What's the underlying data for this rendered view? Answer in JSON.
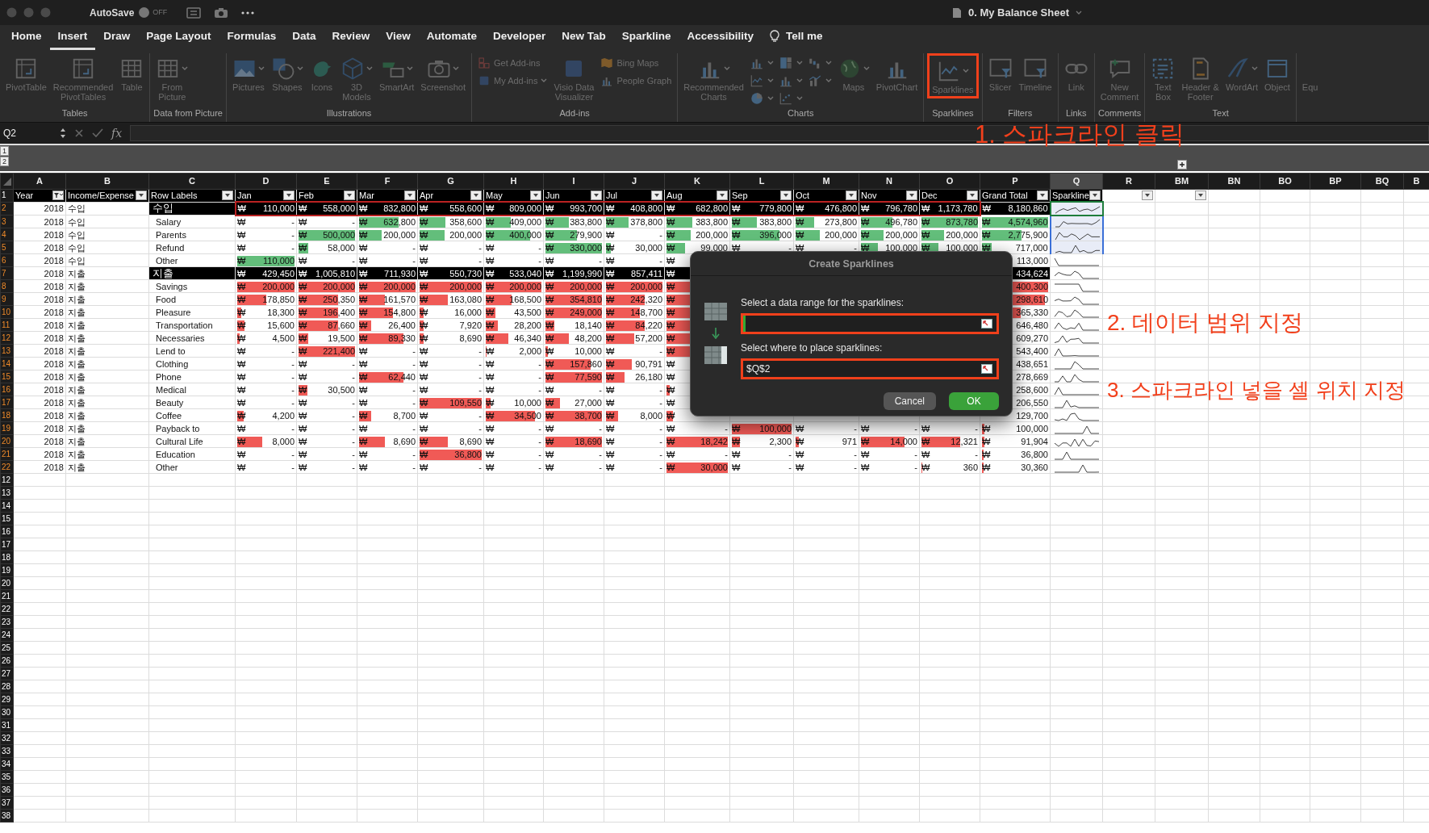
{
  "titlebar": {
    "autosave": {
      "label": "AutoSave",
      "on": false,
      "state_text": "OFF"
    },
    "title": "0. My Balance Sheet"
  },
  "tabs": [
    {
      "label": "Home",
      "selected": false
    },
    {
      "label": "Insert",
      "selected": true
    },
    {
      "label": "Draw",
      "selected": false
    },
    {
      "label": "Page Layout",
      "selected": false
    },
    {
      "label": "Formulas",
      "selected": false
    },
    {
      "label": "Data",
      "selected": false
    },
    {
      "label": "Review",
      "selected": false
    },
    {
      "label": "View",
      "selected": false
    },
    {
      "label": "Automate",
      "selected": false
    },
    {
      "label": "Developer",
      "selected": false
    },
    {
      "label": "New Tab",
      "selected": false
    },
    {
      "label": "Sparkline",
      "selected": false
    },
    {
      "label": "Accessibility",
      "selected": false
    }
  ],
  "tell_me": "Tell me",
  "ribbon": {
    "disabled": true,
    "groups": [
      {
        "label": "Tables",
        "buttons": [
          {
            "kind": "large",
            "label": "PivotTable"
          },
          {
            "kind": "large",
            "label": "Recommended\nPivotTables"
          },
          {
            "kind": "large",
            "label": "Table"
          }
        ]
      },
      {
        "label": "Data from Picture",
        "buttons": [
          {
            "kind": "large",
            "label": "From\nPicture",
            "menu": true
          }
        ]
      },
      {
        "label": "Illustrations",
        "buttons": [
          {
            "kind": "large",
            "label": "Pictures",
            "menu": true
          },
          {
            "kind": "large",
            "label": "Shapes",
            "menu": true
          },
          {
            "kind": "large",
            "label": "Icons"
          },
          {
            "kind": "large",
            "label": "3D\nModels",
            "menu": true
          },
          {
            "kind": "large",
            "label": "SmartArt",
            "menu": true
          },
          {
            "kind": "large",
            "label": "Screenshot",
            "menu": true
          }
        ]
      },
      {
        "label": "Add-ins",
        "buttons": [
          {
            "kind": "stack",
            "buttons": [
              {
                "kind": "small",
                "label": "Get Add-ins"
              },
              {
                "kind": "small",
                "label": "My Add-ins",
                "menu": true
              }
            ]
          },
          {
            "kind": "large",
            "label": "Visio Data\nVisualizer"
          },
          {
            "kind": "stack",
            "buttons": [
              {
                "kind": "small",
                "label": "Bing Maps"
              },
              {
                "kind": "small",
                "label": "People Graph"
              }
            ]
          }
        ]
      },
      {
        "label": "Charts",
        "buttons": [
          {
            "kind": "large",
            "label": "Recommended\nCharts",
            "menu": true
          },
          {
            "kind": "stack",
            "buttons": [
              {
                "kind": "icon",
                "menu": true
              },
              {
                "kind": "icon",
                "menu": true
              },
              {
                "kind": "icon",
                "menu": true
              }
            ]
          },
          {
            "kind": "stack",
            "buttons": [
              {
                "kind": "icon",
                "menu": true
              },
              {
                "kind": "icon",
                "menu": true
              },
              {
                "kind": "icon",
                "menu": true
              }
            ]
          },
          {
            "kind": "stack",
            "buttons": [
              {
                "kind": "icon",
                "menu": true
              },
              {
                "kind": "icon",
                "menu": true
              }
            ]
          },
          {
            "kind": "large",
            "label": "Maps",
            "menu": true
          },
          {
            "kind": "large",
            "label": "PivotChart"
          }
        ]
      },
      {
        "label": "Sparklines",
        "buttons": [
          {
            "kind": "large",
            "label": "Sparklines",
            "menu": true,
            "annotated": true
          }
        ]
      },
      {
        "label": "Filters",
        "buttons": [
          {
            "kind": "large",
            "label": "Slicer"
          },
          {
            "kind": "large",
            "label": "Timeline"
          }
        ]
      },
      {
        "label": "Links",
        "buttons": [
          {
            "kind": "large",
            "label": "Link"
          }
        ]
      },
      {
        "label": "Comments",
        "buttons": [
          {
            "kind": "large",
            "label": "New\nComment"
          }
        ]
      },
      {
        "label": "Text",
        "buttons": [
          {
            "kind": "large",
            "label": "Text\nBox"
          },
          {
            "kind": "large",
            "label": "Header &\nFooter"
          },
          {
            "kind": "large",
            "label": "WordArt",
            "menu": true
          },
          {
            "kind": "large",
            "label": "Object"
          }
        ]
      },
      {
        "buttons": [
          {
            "kind": "large",
            "label": "Equ"
          }
        ]
      }
    ]
  },
  "formula_bar": {
    "name_box": "Q2",
    "fx_label": "fx"
  },
  "outline": {
    "levels": [
      "1",
      "2"
    ]
  },
  "columns": [
    {
      "label": "A",
      "selected": false
    },
    {
      "label": "B",
      "selected": false
    },
    {
      "label": "C",
      "selected": false
    },
    {
      "label": "D",
      "selected": false
    },
    {
      "label": "E",
      "selected": false
    },
    {
      "label": "F",
      "selected": false
    },
    {
      "label": "G",
      "selected": false
    },
    {
      "label": "H",
      "selected": false
    },
    {
      "label": "I",
      "selected": false
    },
    {
      "label": "J",
      "selected": false
    },
    {
      "label": "K",
      "selected": false
    },
    {
      "label": "L",
      "selected": false
    },
    {
      "label": "M",
      "selected": false
    },
    {
      "label": "N",
      "selected": false
    },
    {
      "label": "O",
      "selected": false
    },
    {
      "label": "P",
      "selected": false
    },
    {
      "label": "Q",
      "selected": true
    },
    {
      "label": "R",
      "selected": false
    },
    {
      "label": "BM",
      "selected": false
    },
    {
      "label": "BN",
      "selected": false
    },
    {
      "label": "BO",
      "selected": false
    },
    {
      "label": "BP",
      "selected": false
    },
    {
      "label": "BQ",
      "selected": false
    },
    {
      "label": "B",
      "selected": false
    }
  ],
  "header_row": {
    "num": "1",
    "cells": [
      {
        "label": "Year",
        "filtered": true
      },
      {
        "label": "Income/Expense",
        "filtered": false
      },
      {
        "label": "Row Labels",
        "filtered": false
      },
      {
        "label": "Jan",
        "filtered": false
      },
      {
        "label": "Feb",
        "filtered": false
      },
      {
        "label": "Mar",
        "filtered": false
      },
      {
        "label": "Apr",
        "filtered": false
      },
      {
        "label": "May",
        "filtered": false
      },
      {
        "label": "Jun",
        "filtered": false
      },
      {
        "label": "Jul",
        "filtered": false
      },
      {
        "label": "Aug",
        "filtered": false
      },
      {
        "label": "Sep",
        "filtered": false
      },
      {
        "label": "Oct",
        "filtered": false
      },
      {
        "label": "Nov",
        "filtered": false
      },
      {
        "label": "Dec",
        "filtered": false
      },
      {
        "label": "Grand Total",
        "filtered": false
      },
      {
        "label": "Sparkline",
        "filtered": false
      },
      {
        "filtered": false
      },
      {
        "filtered": false
      }
    ]
  },
  "rows": [
    {
      "num": "2",
      "year": "2018",
      "type": "수입",
      "label": "수입",
      "kind": "income_total",
      "spark": {
        "selected": true,
        "active": true
      },
      "cells": [
        {
          "cur": "₩",
          "amt": "110,000"
        },
        {
          "cur": "₩",
          "amt": "558,000"
        },
        {
          "cur": "₩",
          "amt": "832,800"
        },
        {
          "cur": "₩",
          "amt": "558,600"
        },
        {
          "cur": "₩",
          "amt": "809,000"
        },
        {
          "cur": "₩",
          "amt": "993,700"
        },
        {
          "cur": "₩",
          "amt": "408,800"
        },
        {
          "cur": "₩",
          "amt": "682,800"
        },
        {
          "cur": "₩",
          "amt": "779,800"
        },
        {
          "cur": "₩",
          "amt": "476,800"
        },
        {
          "cur": "₩",
          "amt": "796,780"
        },
        {
          "cur": "₩",
          "amt": "1,173,780"
        },
        {
          "cur": "₩",
          "amt": "8,180,860"
        }
      ]
    },
    {
      "num": "3",
      "year": "2018",
      "type": "수입",
      "label": "Salary",
      "kind": "income",
      "spark": {
        "selected": true,
        "active": false
      },
      "cells": [
        {
          "cur": "₩",
          "amt": "-"
        },
        {
          "cur": "₩",
          "amt": "-"
        },
        {
          "cur": "₩",
          "amt": "632,800",
          "level": 0.7
        },
        {
          "cur": "₩",
          "amt": "358,600",
          "level": 0.42
        },
        {
          "cur": "₩",
          "amt": "409,000",
          "level": 0.45
        },
        {
          "cur": "₩",
          "amt": "383,800",
          "level": 0.42
        },
        {
          "cur": "₩",
          "amt": "378,800",
          "level": 0.4
        },
        {
          "cur": "₩",
          "amt": "383,800",
          "level": 0.42
        },
        {
          "cur": "₩",
          "amt": "383,800",
          "level": 0.42
        },
        {
          "cur": "₩",
          "amt": "273,800",
          "level": 0.3
        },
        {
          "cur": "₩",
          "amt": "496,780",
          "level": 0.56
        },
        {
          "cur": "₩",
          "amt": "873,780",
          "level": 1
        },
        {
          "cur": "₩",
          "amt": "4,574,960",
          "level": 1
        }
      ]
    },
    {
      "num": "4",
      "year": "2018",
      "type": "수입",
      "label": "Parents",
      "kind": "income",
      "spark": {
        "selected": true,
        "active": false
      },
      "cells": [
        {
          "cur": "₩",
          "amt": "-"
        },
        {
          "cur": "₩",
          "amt": "500,000",
          "level": 1
        },
        {
          "cur": "₩",
          "amt": "200,000",
          "level": 0.4
        },
        {
          "cur": "₩",
          "amt": "200,000",
          "level": 0.4
        },
        {
          "cur": "₩",
          "amt": "400,000",
          "level": 0.8
        },
        {
          "cur": "₩",
          "amt": "279,900",
          "level": 0.55
        },
        {
          "cur": "₩",
          "amt": "-"
        },
        {
          "cur": "₩",
          "amt": "200,000",
          "level": 0.4
        },
        {
          "cur": "₩",
          "amt": "396,000",
          "level": 0.8
        },
        {
          "cur": "₩",
          "amt": "200,000",
          "level": 0.4
        },
        {
          "cur": "₩",
          "amt": "200,000",
          "level": 0.4
        },
        {
          "cur": "₩",
          "amt": "200,000",
          "level": 0.4
        },
        {
          "cur": "₩",
          "amt": "2,775,900",
          "level": 0.6
        }
      ]
    },
    {
      "num": "5",
      "year": "2018",
      "type": "수입",
      "label": "Refund",
      "kind": "income",
      "spark": {
        "selected": true,
        "active": false
      },
      "cells": [
        {
          "cur": "₩",
          "amt": "-"
        },
        {
          "cur": "₩",
          "amt": "58,000",
          "level": 0.17
        },
        {
          "cur": "₩",
          "amt": "-"
        },
        {
          "cur": "₩",
          "amt": "-"
        },
        {
          "cur": "₩",
          "amt": "-"
        },
        {
          "cur": "₩",
          "amt": "330,000",
          "level": 1
        },
        {
          "cur": "₩",
          "amt": "30,000",
          "level": 0.09
        },
        {
          "cur": "₩",
          "amt": "99,000",
          "level": 0.3
        },
        {
          "cur": "₩",
          "amt": "-"
        },
        {
          "cur": "₩",
          "amt": "-"
        },
        {
          "cur": "₩",
          "amt": "100,000",
          "level": 0.3
        },
        {
          "cur": "₩",
          "amt": "100,000",
          "level": 0.3
        },
        {
          "cur": "₩",
          "amt": "717,000",
          "level": 0.15
        }
      ]
    },
    {
      "num": "6",
      "year": "2018",
      "type": "수입",
      "label": "Other",
      "kind": "income",
      "spark": {
        "selected": false,
        "active": false
      },
      "cells": [
        {
          "cur": "₩",
          "amt": "110,000",
          "level": 1
        },
        {
          "cur": "₩",
          "amt": "-"
        },
        {
          "cur": "₩",
          "amt": "-"
        },
        {
          "cur": "₩",
          "amt": "-"
        },
        {
          "cur": "₩",
          "amt": "-"
        },
        {
          "cur": "₩",
          "amt": "-"
        },
        {
          "cur": "₩",
          "amt": "-"
        },
        {
          "cur": "₩"
        },
        null,
        null,
        null,
        null,
        {
          "amt": "113,000"
        }
      ]
    },
    {
      "num": "7",
      "year": "2018",
      "type": "지출",
      "label": "지출",
      "kind": "expense_total",
      "spark": {
        "selected": false,
        "active": false
      },
      "cells": [
        {
          "cur": "₩",
          "amt": "429,450"
        },
        {
          "cur": "₩",
          "amt": "1,005,810"
        },
        {
          "cur": "₩",
          "amt": "711,930"
        },
        {
          "cur": "₩",
          "amt": "550,730"
        },
        {
          "cur": "₩",
          "amt": "533,040"
        },
        {
          "cur": "₩",
          "amt": "1,199,990"
        },
        {
          "cur": "₩",
          "amt": "857,411"
        },
        {
          "cur": "₩"
        },
        null,
        null,
        null,
        null,
        {
          "amt": "434,624"
        }
      ]
    },
    {
      "num": "8",
      "year": "2018",
      "type": "지출",
      "label": "Savings",
      "kind": "expense",
      "spark": {
        "selected": false,
        "active": false
      },
      "cells": [
        {
          "cur": "₩",
          "amt": "200,000",
          "level": 1
        },
        {
          "cur": "₩",
          "amt": "200,000",
          "level": 1
        },
        {
          "cur": "₩",
          "amt": "200,000",
          "level": 1
        },
        {
          "cur": "₩",
          "amt": "200,000",
          "level": 1
        },
        {
          "cur": "₩",
          "amt": "200,000",
          "level": 1
        },
        {
          "cur": "₩",
          "amt": "200,000",
          "level": 1
        },
        {
          "cur": "₩",
          "amt": "200,000",
          "level": 1
        },
        {
          "cur": "₩",
          "level": 1
        },
        null,
        null,
        null,
        null,
        {
          "amt": "400,300",
          "level": 1
        }
      ]
    },
    {
      "num": "9",
      "year": "2018",
      "type": "지출",
      "label": "Food",
      "kind": "expense",
      "spark": {
        "selected": false,
        "active": false
      },
      "cells": [
        {
          "cur": "₩",
          "amt": "178,850",
          "level": 0.5
        },
        {
          "cur": "₩",
          "amt": "250,350",
          "level": 0.7
        },
        {
          "cur": "₩",
          "amt": "161,570",
          "level": 0.45
        },
        {
          "cur": "₩",
          "amt": "163,080",
          "level": 0.46
        },
        {
          "cur": "₩",
          "amt": "168,500",
          "level": 0.47
        },
        {
          "cur": "₩",
          "amt": "354,810",
          "level": 1
        },
        {
          "cur": "₩",
          "amt": "242,320",
          "level": 0.68
        },
        {
          "cur": "₩",
          "level": 0.5
        },
        null,
        null,
        null,
        null,
        {
          "amt": "298,610",
          "level": 0.95
        }
      ]
    },
    {
      "num": "10",
      "year": "2018",
      "type": "지출",
      "label": "Pleasure",
      "kind": "expense",
      "spark": {
        "selected": false,
        "active": false
      },
      "cells": [
        {
          "cur": "₩",
          "amt": "18,300",
          "level": 0.07
        },
        {
          "cur": "₩",
          "amt": "196,400",
          "level": 0.7
        },
        {
          "cur": "₩",
          "amt": "154,800",
          "level": 0.6
        },
        {
          "cur": "₩",
          "amt": "16,000",
          "level": 0.06
        },
        {
          "cur": "₩",
          "amt": "43,500",
          "level": 0.17
        },
        {
          "cur": "₩",
          "amt": "249,000",
          "level": 1
        },
        {
          "cur": "₩",
          "amt": "148,700",
          "level": 0.6
        },
        {
          "cur": "₩",
          "level": 0.5
        },
        null,
        null,
        null,
        null,
        {
          "amt": "365,330",
          "level": 0.58
        }
      ]
    },
    {
      "num": "11",
      "year": "2018",
      "type": "지출",
      "label": "Transportation",
      "kind": "expense",
      "spark": {
        "selected": false,
        "active": false
      },
      "cells": [
        {
          "cur": "₩",
          "amt": "15,600",
          "level": 0.13
        },
        {
          "cur": "₩",
          "amt": "87,660",
          "level": 0.7
        },
        {
          "cur": "₩",
          "amt": "26,400",
          "level": 0.22
        },
        {
          "cur": "₩",
          "amt": "7,920",
          "level": 0.06
        },
        {
          "cur": "₩",
          "amt": "28,200",
          "level": 0.22
        },
        {
          "cur": "₩",
          "amt": "18,140",
          "level": 0.15
        },
        {
          "cur": "₩",
          "amt": "84,220",
          "level": 0.68
        },
        {
          "cur": "₩",
          "level": 0.5
        },
        null,
        null,
        null,
        null,
        {
          "amt": "646,480"
        }
      ]
    },
    {
      "num": "12",
      "year": "2018",
      "type": "지출",
      "label": "Necessaries",
      "kind": "expense",
      "spark": {
        "selected": false,
        "active": false
      },
      "cells": [
        {
          "cur": "₩",
          "amt": "4,500",
          "level": 0.04
        },
        {
          "cur": "₩",
          "amt": "19,500",
          "level": 0.17
        },
        {
          "cur": "₩",
          "amt": "89,330",
          "level": 0.78
        },
        {
          "cur": "₩",
          "amt": "8,690",
          "level": 0.07
        },
        {
          "cur": "₩",
          "amt": "46,340",
          "level": 0.4
        },
        {
          "cur": "₩",
          "amt": "48,200",
          "level": 0.42
        },
        {
          "cur": "₩",
          "amt": "57,200",
          "level": 0.5
        },
        {
          "cur": "₩",
          "level": 0.5
        },
        null,
        null,
        null,
        null,
        {
          "amt": "609,270"
        }
      ]
    },
    {
      "num": "13",
      "year": "2018",
      "type": "지출",
      "label": "Lend to",
      "kind": "expense",
      "spark": {
        "selected": false,
        "active": false
      },
      "cells": [
        {
          "cur": "₩",
          "amt": "-"
        },
        {
          "cur": "₩",
          "amt": "221,400",
          "level": 1
        },
        {
          "cur": "₩",
          "amt": "-"
        },
        {
          "cur": "₩",
          "amt": "-"
        },
        {
          "cur": "₩",
          "amt": "2,000",
          "level": 0.01
        },
        {
          "cur": "₩",
          "amt": "10,000",
          "level": 0.04
        },
        {
          "cur": "₩",
          "amt": "-"
        },
        {
          "cur": "₩",
          "level": 0.5
        },
        null,
        null,
        null,
        null,
        {
          "amt": "543,400"
        }
      ]
    },
    {
      "num": "14",
      "year": "2018",
      "type": "지출",
      "label": "Clothing",
      "kind": "expense",
      "spark": {
        "selected": false,
        "active": false
      },
      "cells": [
        {
          "cur": "₩",
          "amt": "-"
        },
        {
          "cur": "₩",
          "amt": "-"
        },
        {
          "cur": "₩",
          "amt": "-"
        },
        {
          "cur": "₩",
          "amt": "-"
        },
        {
          "cur": "₩",
          "amt": "-"
        },
        {
          "cur": "₩",
          "amt": "157,860",
          "level": 0.8
        },
        {
          "cur": "₩",
          "amt": "90,791",
          "level": 0.46
        },
        {
          "cur": "₩"
        },
        null,
        null,
        null,
        null,
        {
          "amt": "438,651"
        }
      ]
    },
    {
      "num": "15",
      "year": "2018",
      "type": "지출",
      "label": "Phone",
      "kind": "expense",
      "spark": {
        "selected": false,
        "active": false
      },
      "cells": [
        {
          "cur": "₩",
          "amt": "-"
        },
        {
          "cur": "₩",
          "amt": "-"
        },
        {
          "cur": "₩",
          "amt": "62,440",
          "level": 0.78
        },
        {
          "cur": "₩",
          "amt": "-"
        },
        {
          "cur": "₩",
          "amt": "-"
        },
        {
          "cur": "₩",
          "amt": "77,590",
          "level": 1
        },
        {
          "cur": "₩",
          "amt": "26,180",
          "level": 0.33
        },
        {
          "cur": "₩"
        },
        null,
        null,
        null,
        null,
        {
          "amt": "278,669"
        }
      ]
    },
    {
      "num": "16",
      "year": "2018",
      "type": "지출",
      "label": "Medical",
      "kind": "expense",
      "spark": {
        "selected": false,
        "active": false
      },
      "cells": [
        {
          "cur": "₩",
          "amt": "-"
        },
        {
          "cur": "₩",
          "amt": "30,500",
          "level": 0.15
        },
        {
          "cur": "₩",
          "amt": "-"
        },
        {
          "cur": "₩",
          "amt": "-"
        },
        {
          "cur": "₩",
          "amt": "-"
        },
        {
          "cur": "₩",
          "amt": "-"
        },
        {
          "cur": "₩",
          "amt": "-"
        },
        {
          "cur": "₩",
          "level": 0.05
        },
        null,
        null,
        null,
        null,
        {
          "amt": "258,600"
        }
      ]
    },
    {
      "num": "17",
      "year": "2018",
      "type": "지출",
      "label": "Beauty",
      "kind": "expense",
      "spark": {
        "selected": false,
        "active": false
      },
      "cells": [
        {
          "cur": "₩",
          "amt": "-"
        },
        {
          "cur": "₩",
          "amt": "-"
        },
        {
          "cur": "₩",
          "amt": "-"
        },
        {
          "cur": "₩",
          "amt": "109,550",
          "level": 1
        },
        {
          "cur": "₩",
          "amt": "10,000",
          "level": 0.09
        },
        {
          "cur": "₩",
          "amt": "27,000",
          "level": 0.25
        },
        {
          "cur": "₩",
          "amt": "-"
        },
        {
          "cur": "₩"
        },
        null,
        null,
        null,
        null,
        {
          "amt": "206,550"
        }
      ]
    },
    {
      "num": "18",
      "year": "2018",
      "type": "지출",
      "label": "Coffee",
      "kind": "expense",
      "spark": {
        "selected": false,
        "active": false
      },
      "cells": [
        {
          "cur": "₩",
          "amt": "4,200",
          "level": 0.11
        },
        {
          "cur": "₩",
          "amt": "-"
        },
        {
          "cur": "₩",
          "amt": "8,700",
          "level": 0.22
        },
        {
          "cur": "₩",
          "amt": "-"
        },
        {
          "cur": "₩",
          "amt": "34,500",
          "level": 0.89
        },
        {
          "cur": "₩",
          "amt": "38,700",
          "level": 1
        },
        {
          "cur": "₩",
          "amt": "8,000",
          "level": 0.21
        },
        {
          "cur": "₩",
          "level": 0.1
        },
        null,
        null,
        null,
        null,
        {
          "amt": "129,700"
        }
      ]
    },
    {
      "num": "19",
      "year": "2018",
      "type": "지출",
      "label": "Payback to",
      "kind": "expense",
      "spark": {
        "selected": false,
        "active": false
      },
      "cells": [
        {
          "cur": "₩",
          "amt": "-"
        },
        {
          "cur": "₩",
          "amt": "-"
        },
        {
          "cur": "₩",
          "amt": "-"
        },
        {
          "cur": "₩",
          "amt": "-"
        },
        {
          "cur": "₩",
          "amt": "-"
        },
        {
          "cur": "₩",
          "amt": "-"
        },
        {
          "cur": "₩",
          "amt": "-"
        },
        {
          "cur": "₩",
          "amt": "-"
        },
        {
          "cur": "₩",
          "amt": "100,000",
          "level": 1
        },
        {
          "cur": "₩",
          "amt": "-"
        },
        {
          "cur": "₩",
          "amt": "-"
        },
        {
          "cur": "₩",
          "amt": "-"
        },
        {
          "cur": "₩",
          "amt": "100,000",
          "level": 0.04
        }
      ]
    },
    {
      "num": "20",
      "year": "2018",
      "type": "지출",
      "label": "Cultural Life",
      "kind": "expense",
      "spark": {
        "selected": false,
        "active": false
      },
      "cells": [
        {
          "cur": "₩",
          "amt": "8,000",
          "level": 0.43
        },
        {
          "cur": "₩",
          "amt": "-"
        },
        {
          "cur": "₩",
          "amt": "8,690",
          "level": 0.46
        },
        {
          "cur": "₩",
          "amt": "8,690",
          "level": 0.46
        },
        {
          "cur": "₩",
          "amt": "-"
        },
        {
          "cur": "₩",
          "amt": "18,690",
          "level": 1
        },
        {
          "cur": "₩",
          "amt": "-"
        },
        {
          "cur": "₩",
          "amt": "18,242",
          "level": 1
        },
        {
          "cur": "₩",
          "amt": "2,300",
          "level": 0.13
        },
        {
          "cur": "₩",
          "amt": "971",
          "level": 0.05
        },
        {
          "cur": "₩",
          "amt": "14,000",
          "level": 0.77
        },
        {
          "cur": "₩",
          "amt": "12,321",
          "level": 0.68
        },
        {
          "cur": "₩",
          "amt": "91,904",
          "level": 0.04
        }
      ]
    },
    {
      "num": "21",
      "year": "2018",
      "type": "지출",
      "label": "Education",
      "kind": "expense",
      "spark": {
        "selected": false,
        "active": false
      },
      "cells": [
        {
          "cur": "₩",
          "amt": "-"
        },
        {
          "cur": "₩",
          "amt": "-"
        },
        {
          "cur": "₩",
          "amt": "-"
        },
        {
          "cur": "₩",
          "amt": "36,800",
          "level": 1
        },
        {
          "cur": "₩",
          "amt": "-"
        },
        {
          "cur": "₩",
          "amt": "-"
        },
        {
          "cur": "₩",
          "amt": "-"
        },
        {
          "cur": "₩",
          "amt": "-"
        },
        {
          "cur": "₩",
          "amt": "-"
        },
        {
          "cur": "₩",
          "amt": "-"
        },
        {
          "cur": "₩",
          "amt": "-"
        },
        {
          "cur": "₩",
          "amt": "-"
        },
        {
          "cur": "₩",
          "amt": "36,800",
          "level": 0.02
        }
      ]
    },
    {
      "num": "22",
      "year": "2018",
      "type": "지출",
      "label": "Other",
      "kind": "expense",
      "spark": {
        "selected": false,
        "active": false
      },
      "cells": [
        {
          "cur": "₩",
          "amt": "-"
        },
        {
          "cur": "₩",
          "amt": "-"
        },
        {
          "cur": "₩",
          "amt": "-"
        },
        {
          "cur": "₩",
          "amt": "-"
        },
        {
          "cur": "₩",
          "amt": "-"
        },
        {
          "cur": "₩",
          "amt": "-"
        },
        {
          "cur": "₩",
          "amt": "-"
        },
        {
          "cur": "₩",
          "amt": "30,000",
          "level": 1
        },
        {
          "cur": "₩",
          "amt": "-"
        },
        {
          "cur": "₩",
          "amt": "-"
        },
        {
          "cur": "₩",
          "amt": "-"
        },
        {
          "cur": "₩",
          "amt": "360",
          "level": 0.01
        },
        {
          "cur": "₩",
          "amt": "30,360",
          "level": 0.02
        }
      ]
    }
  ],
  "empty_rows": [
    "12",
    "13",
    "14",
    "15",
    "16",
    "17",
    "18",
    "19",
    "20",
    "21",
    "22",
    "23",
    "24",
    "25",
    "26",
    "27",
    "28",
    "29",
    "30",
    "31",
    "32",
    "33",
    "34",
    "35",
    "36",
    "37",
    "38"
  ],
  "dialog": {
    "title": "Create Sparklines",
    "fields": [
      {
        "label": "Select a data range for the sparklines:",
        "focused": true,
        "annotated": true
      },
      {
        "label": "Select where to place sparklines:",
        "value": "$Q$2",
        "focused": false,
        "annotated": true
      }
    ],
    "buttons": [
      {
        "label": "Cancel",
        "kind": "secondary"
      },
      {
        "label": "OK",
        "kind": "primary"
      }
    ]
  },
  "annotations": [
    "1. 스파크라인 클릭",
    "2. 데이터 범위 지정",
    "3. 스파크라인 넣을 셀 위치 지정"
  ]
}
